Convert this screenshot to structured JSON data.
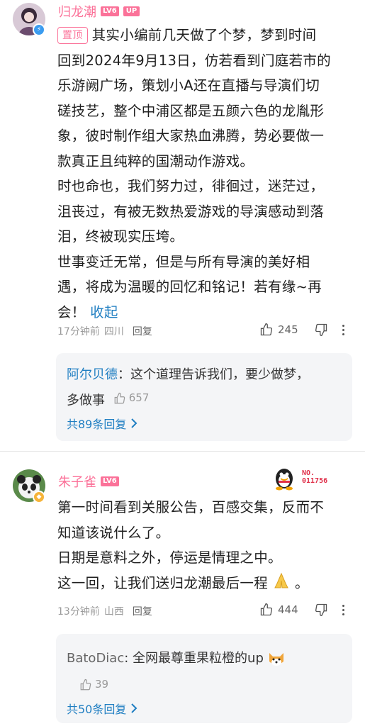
{
  "comment1": {
    "username": "归龙潮",
    "level": "LV6",
    "up_badge": "UP",
    "pinned_label": "置顶",
    "lines": [
      "其实小编前几天做了个梦，梦到时间",
      "回到2024年9月13日，仿若看到门庭若市的",
      "乐游阙广场，策划小A还在直播与导演们切",
      "磋技艺，整个中浦区都是五颜六色的龙胤形",
      "象，彼时制作组大家热血沸腾，势必要做一",
      "款真正且纯粹的国潮动作游戏。",
      "时也命也，我们努力过，徘徊过，迷茫过，",
      "沮丧过，有被无数热爱游戏的导演感动到落",
      "泪，终被现实压垮。",
      "世事变迁无常，但是与所有导演的美好相",
      "遇，将成为温暖的回忆和铭记！若有缘~再",
      "会！"
    ],
    "collapse_label": "收起",
    "time": "17分钟前",
    "location": "四川",
    "reply_label": "回复",
    "likes": "245",
    "sub_reply": {
      "author": "阿尔贝德",
      "line1": "：这个道理告诉我们，要少做梦，",
      "line2": "多做事",
      "likes": "657"
    },
    "total_replies": "共89条回复"
  },
  "comment2": {
    "username": "朱子雀",
    "level": "LV6",
    "stamp_no": "NO.",
    "stamp_number": "011756",
    "lines": [
      "第一时间看到关服公告，百感交集，反而不",
      "知道该说什么了。",
      "日期是意料之外，停运是情理之中。",
      "这一回，让我们送归龙潮最后一程"
    ],
    "line_end": "。",
    "time": "13分钟前",
    "location": "山西",
    "reply_label": "回复",
    "likes": "444",
    "sub_reply": {
      "author": "BatoDiac",
      "text": ": 全网最尊重果粒橙的up",
      "likes": "39"
    },
    "total_replies": "共50条回复"
  },
  "colors": {
    "accent_pink": "#fb7299",
    "link_blue": "#1f7ec2",
    "meta_gray": "#9a9a9a",
    "reply_bg": "#f4f5f7"
  }
}
